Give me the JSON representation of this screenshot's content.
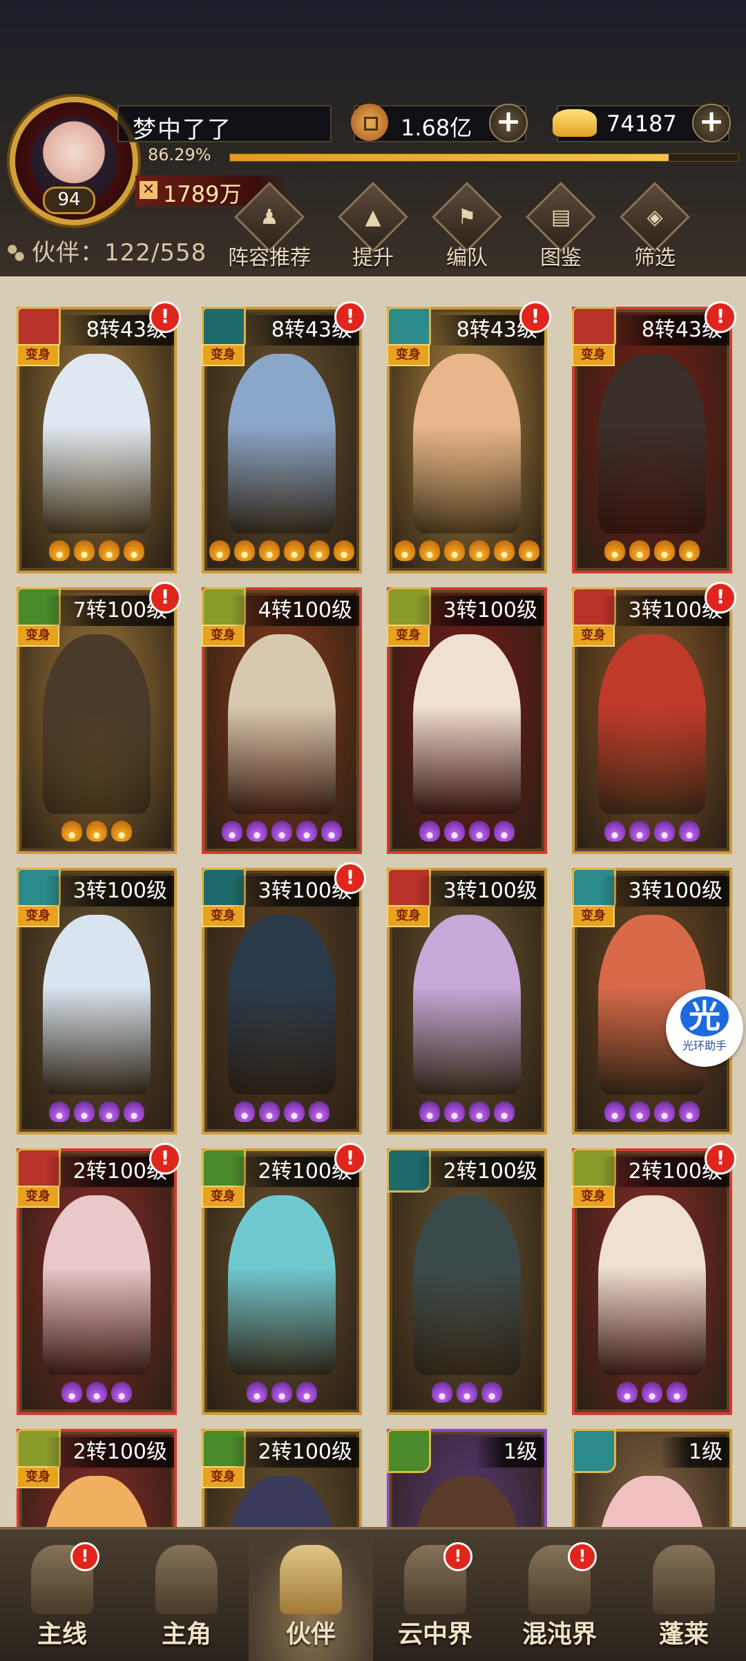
{
  "player": {
    "name": "梦中了了",
    "level": "94",
    "exp_percent": "86.29%",
    "exp_fraction": 0.8629,
    "power": "1789万"
  },
  "resources": {
    "copper": "1.68亿",
    "gold": "74187",
    "plus": "+"
  },
  "partner_count": "伙伴：122/558",
  "toolbar": [
    {
      "label": "阵容推荐",
      "icon": "recommend-icon",
      "glyph": "♟"
    },
    {
      "label": "提升",
      "icon": "upgrade-icon",
      "glyph": "▲"
    },
    {
      "label": "编队",
      "icon": "formation-icon",
      "glyph": "⚑"
    },
    {
      "label": "图鉴",
      "icon": "codex-icon",
      "glyph": "▤"
    },
    {
      "label": "筛选",
      "icon": "filter-icon",
      "glyph": "◈"
    }
  ],
  "badges": {
    "bianshen": "变身",
    "alert": "!"
  },
  "cards": [
    {
      "level": "8转43级",
      "border": "gold",
      "elem": "#b8322a",
      "bianshen": true,
      "alert": true,
      "stars": 4,
      "star_color": "gold",
      "bg": "#9c7a3a",
      "fig": "#dfe8f0"
    },
    {
      "level": "8转43级",
      "border": "gold",
      "elem": "#1f6b6b",
      "bianshen": true,
      "alert": true,
      "stars": 6,
      "star_color": "gold",
      "bg": "#6a5430",
      "fig": "#8aa6c8"
    },
    {
      "level": "8转43级",
      "border": "gold",
      "elem": "#2b8a8a",
      "bianshen": true,
      "alert": true,
      "stars": 6,
      "star_color": "gold",
      "bg": "#b08840",
      "fig": "#e8b68a"
    },
    {
      "level": "8转43级",
      "border": "red",
      "elem": "#b8322a",
      "bianshen": true,
      "alert": true,
      "stars": 4,
      "star_color": "gold",
      "bg": "#7a1d18",
      "fig": "#3a2f2a"
    },
    {
      "level": "7转100级",
      "border": "gold",
      "elem": "#4a8a2a",
      "bianshen": true,
      "alert": true,
      "stars": 3,
      "star_color": "gold",
      "bg": "#a07a3a",
      "fig": "#4a3a2a"
    },
    {
      "level": "4转100级",
      "border": "red",
      "elem": "#8a9a2a",
      "bianshen": true,
      "alert": false,
      "stars": 5,
      "star_color": "purple",
      "bg": "#8a3a1a",
      "fig": "#d8c8b0"
    },
    {
      "level": "3转100级",
      "border": "red",
      "elem": "#8a9a2a",
      "bianshen": true,
      "alert": false,
      "stars": 4,
      "star_color": "purple",
      "bg": "#7a1a18",
      "fig": "#f0e0d0"
    },
    {
      "level": "3转100级",
      "border": "gold",
      "elem": "#b8322a",
      "bianshen": true,
      "alert": true,
      "stars": 4,
      "star_color": "purple",
      "bg": "#8a5a2a",
      "fig": "#c03a2a"
    },
    {
      "level": "3转100级",
      "border": "gold",
      "elem": "#2b8a8a",
      "bianshen": true,
      "alert": false,
      "stars": 4,
      "star_color": "purple",
      "bg": "#6a5430",
      "fig": "#d8e4f0"
    },
    {
      "level": "3转100级",
      "border": "gold",
      "elem": "#1f6b6b",
      "bianshen": true,
      "alert": true,
      "stars": 4,
      "star_color": "purple",
      "bg": "#5a4026",
      "fig": "#2a3a4a"
    },
    {
      "level": "3转100级",
      "border": "gold",
      "elem": "#b8322a",
      "bianshen": true,
      "alert": false,
      "stars": 4,
      "star_color": "purple",
      "bg": "#6a5430",
      "fig": "#c8a8d8"
    },
    {
      "level": "3转100级",
      "border": "gold",
      "elem": "#2b8a8a",
      "bianshen": true,
      "alert": false,
      "stars": 4,
      "star_color": "purple",
      "bg": "#6a4a26",
      "fig": "#d86a4a"
    },
    {
      "level": "2转100级",
      "border": "red",
      "elem": "#b8322a",
      "bianshen": true,
      "alert": true,
      "stars": 3,
      "star_color": "purple",
      "bg": "#8a2a28",
      "fig": "#e8c8c8"
    },
    {
      "level": "2转100级",
      "border": "gold",
      "elem": "#4a8a2a",
      "bianshen": true,
      "alert": true,
      "stars": 3,
      "star_color": "purple",
      "bg": "#6a5430",
      "fig": "#70c8d0"
    },
    {
      "level": "2转100级",
      "border": "gold",
      "elem": "#1f6b6b",
      "bianshen": false,
      "alert": false,
      "stars": 3,
      "star_color": "purple",
      "bg": "#6a5430",
      "fig": "#3a4a4a"
    },
    {
      "level": "2转100级",
      "border": "red",
      "elem": "#8a9a2a",
      "bianshen": true,
      "alert": true,
      "stars": 3,
      "star_color": "purple",
      "bg": "#8a2a28",
      "fig": "#f0e0d0"
    },
    {
      "level": "2转100级",
      "border": "red",
      "elem": "#8a9a2a",
      "bianshen": true,
      "alert": false,
      "stars": 0,
      "star_color": "purple",
      "bg": "#8a2a28",
      "fig": "#f0b060"
    },
    {
      "level": "2转100级",
      "border": "gold",
      "elem": "#4a8a2a",
      "bianshen": true,
      "alert": false,
      "stars": 0,
      "star_color": "purple",
      "bg": "#6a5430",
      "fig": "#3a3a5a"
    },
    {
      "level": "1级",
      "border": "purple",
      "elem": "#4a8a2a",
      "bianshen": false,
      "alert": false,
      "stars": 0,
      "star_color": "purple",
      "bg": "#5a3a7a",
      "fig": "#5a3a2a"
    },
    {
      "level": "1级",
      "border": "gold",
      "elem": "#2b8a8a",
      "bianshen": false,
      "alert": false,
      "stars": 0,
      "star_color": "purple",
      "bg": "#8a6a4a",
      "fig": "#f0c0c0"
    }
  ],
  "helper": {
    "glyph": "光",
    "label": "光环助手"
  },
  "nav": [
    {
      "label": "主线",
      "icon": "main-line-icon",
      "active": false,
      "dot": true
    },
    {
      "label": "主角",
      "icon": "hero-icon",
      "active": false,
      "dot": false
    },
    {
      "label": "伙伴",
      "icon": "partner-icon",
      "active": true,
      "dot": false
    },
    {
      "label": "云中界",
      "icon": "cloud-realm-icon",
      "active": false,
      "dot": true
    },
    {
      "label": "混沌界",
      "icon": "chaos-realm-icon",
      "active": false,
      "dot": true
    },
    {
      "label": "蓬莱",
      "icon": "penglai-icon",
      "active": false,
      "dot": false
    }
  ],
  "colors": {
    "accent_gold": "#c99b3b",
    "alert_red": "#e0261c",
    "exp_orange": "#f5c24a"
  }
}
